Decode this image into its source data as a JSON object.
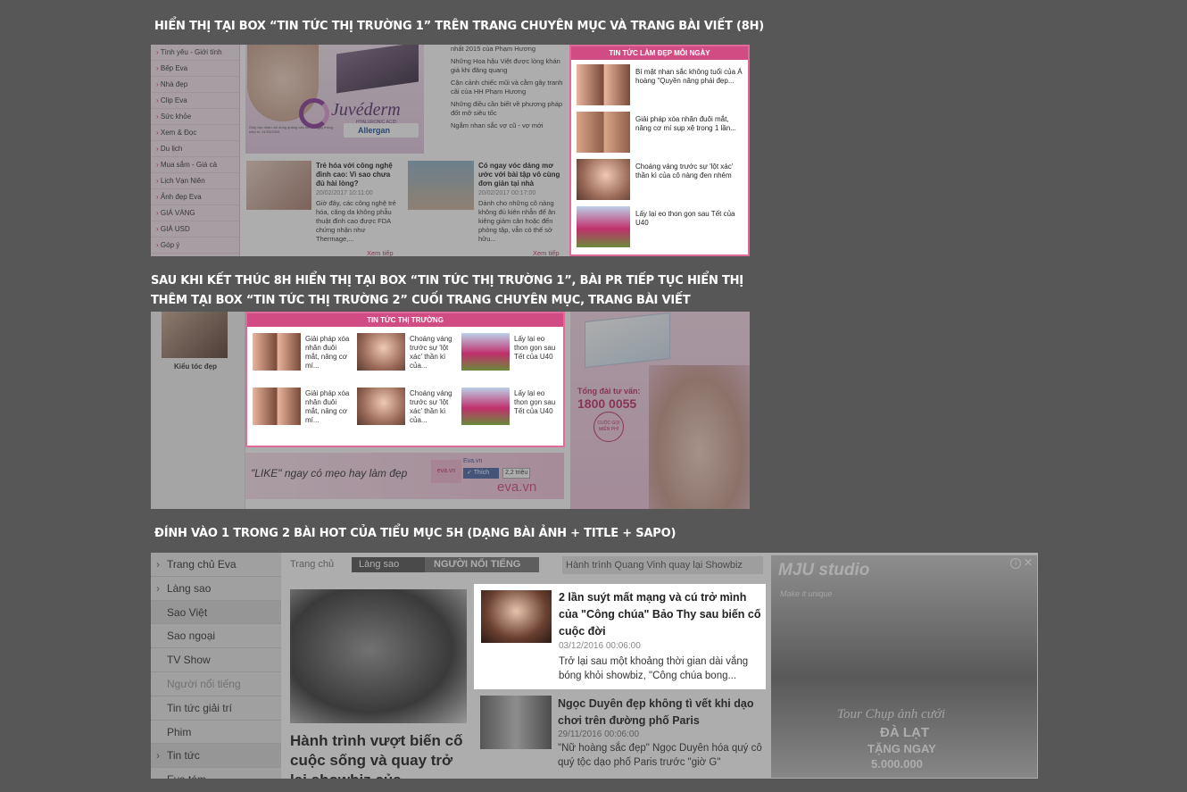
{
  "captions": {
    "c1": "HIỂN THỊ TẠI BOX “TIN TỨC THỊ TRƯỜNG 1” TRÊN TRANG CHUYÊN MỤC VÀ TRANG BÀI VIẾT (8H)",
    "c2a": "SAU KHI KẾT THÚC 8H HIỂN THỊ TẠI BOX “TIN TỨC THỊ TRƯỜNG 1”, BÀI PR TIẾP TỤC HIỂN THỊ",
    "c2b": "THÊM TẠI BOX “TIN TỨC THỊ TRƯỜNG 2” CUỐI TRANG CHUYÊN MỤC, TRANG BÀI VIẾT",
    "c3": "ĐÍNH VÀO 1 TRONG 2 BÀI HOT CỦA TIỂU MỤC 5H (DẠNG BÀI ẢNH + TITLE + SAPO)"
  },
  "shot1": {
    "sidebar": [
      "Tình yêu - Giới tính",
      "Bếp Eva",
      "Nhà đẹp",
      "Clip Eva",
      "Sức khỏe",
      "Xem & Đọc",
      "Du lịch",
      "Mua sắm - Giá cả",
      "Lịch Vạn Niên",
      "Ảnh đẹp Eva",
      "GIÁ VÀNG",
      "GIÁ USD",
      "Góp ý"
    ],
    "ad_brand": "Juvéderm",
    "ad_sub": "HYALURONIC ACID",
    "ad_maker": "Allergan",
    "ad_fine": "Giấy xác nhận nội dung quảng cáo số: ... Ngày tháng năm in: 31/03/2016",
    "list": [
      "nhất 2015 của Phạm Hương",
      "Những Hoa hậu Việt được lòng khán giả khi đăng quang",
      "Cận cảnh chiếc mũi và cằm gây tranh cãi của HH Phạm Hương",
      "Những điều cần biết về phương pháp đốt mỡ siêu tốc",
      "Ngắm nhan sắc vợ cũ - vợ mới"
    ],
    "a1_title": "Trẻ hóa với công nghệ đỉnh cao: Vì sao chưa đủ hài lòng?",
    "a1_date": "20/02/2017 10:11:00",
    "a1_sapo": "Giờ đây, các công nghệ trẻ hóa, căng da không phẫu thuật đỉnh cao được FDA chứng nhận như Thermage,...",
    "a2_title": "Có ngay vóc dáng mơ ước với bài tập vô cùng đơn giản tại nhà",
    "a2_date": "20/02/2017 00:17:00",
    "a2_sapo": "Dành cho những cô nàng không đủ kiên nhẫn để ăn kiêng giảm cân hoặc đến phòng tập, vẫn có thể sở hữu...",
    "more": "Xem tiếp",
    "box_title": "TIN TỨC LÀM ĐẸP MỖI NGÀY",
    "box_items": [
      "Bí mật nhan sắc không tuổi của Á hoàng \"Quyền năng phái đẹp...",
      "Giải pháp xóa nhăn đuôi mắt, nâng cơ mí sụp xệ trong 1 lần...",
      "Choáng váng trước sự 'lột xác' thần kì của cô nàng đen nhẻm",
      "Lấy lại eo thon gọn sau Tết của U40"
    ]
  },
  "shot2": {
    "side_label": "Kiểu tóc đẹp",
    "box_title": "TIN TỨC THỊ TRƯỜNG",
    "items": [
      "Giải pháp xóa nhăn đuôi mắt, nâng cơ mí...",
      "Choáng váng trước sự 'lột xác' thần kì của...",
      "Lấy lại eo thon gọn sau Tết của U40",
      "Giải pháp xóa nhăn đuôi mắt, nâng cơ mí...",
      "Choáng váng trước sự 'lột xác' thần kì của...",
      "Lấy lại eo thon gọn sau Tết của U40"
    ],
    "like_text": "\"LIKE\" ngay có mẹo hay làm đẹp",
    "fb_page": "Eva.vn",
    "fb_like": "Thích",
    "fb_count": "2,2 triệu",
    "eva_logo": "eva.vn",
    "ad_hotline_label": "Tổng đài tư vấn:",
    "ad_hotline": "1800 0055",
    "ad_badge": "CUỘC GỌI MIỄN PHÍ"
  },
  "shot3": {
    "sidebar": [
      "Trang chủ Eva",
      "Làng sao",
      "Sao Việt",
      "Sao ngoại",
      "TV Show",
      "Người nổi tiếng",
      "Tin tức giải trí",
      "Phim",
      "Tin tức",
      "Eva tám"
    ],
    "crumb_home": "Trang chủ",
    "crumb_1": "Làng sao",
    "crumb_2": "NGƯỜI NỔI TIẾNG",
    "crumb_search": "Hành trình Quang Vinh quay lại Showbiz",
    "hero_title": "Hành trình vượt biến cố cuộc sống và quay trở lại showbiz của",
    "hot_title": "2 lần suýt mất mạng và cú trở mình của \"Công chúa\" Bảo Thy sau biến cố cuộc đời",
    "hot_date": "03/12/2016 00:06:00",
    "hot_sapo": "Trở lại sau một khoảng thời gian dài vắng bóng khỏi showbiz, \"Công chúa bong...",
    "b_title": "Ngọc Duyên đẹp không tì vết khi dạo chơi trên đường phố Paris",
    "b_date": "29/11/2016 00:06:00",
    "b_sapo": "\"Nữ hoàng sắc đẹp\" Ngọc Duyên hóa quý cô quý tộc dạo phố Paris trước \"giờ G\"",
    "ad_logo": "MJU studio",
    "ad_slogan": "Make it unique",
    "ad_line1": "Tour Chụp ảnh cưới",
    "ad_line2": "ĐÀ LẠT",
    "ad_line3": "TẶNG NGAY",
    "ad_line4": "5.000.000"
  }
}
